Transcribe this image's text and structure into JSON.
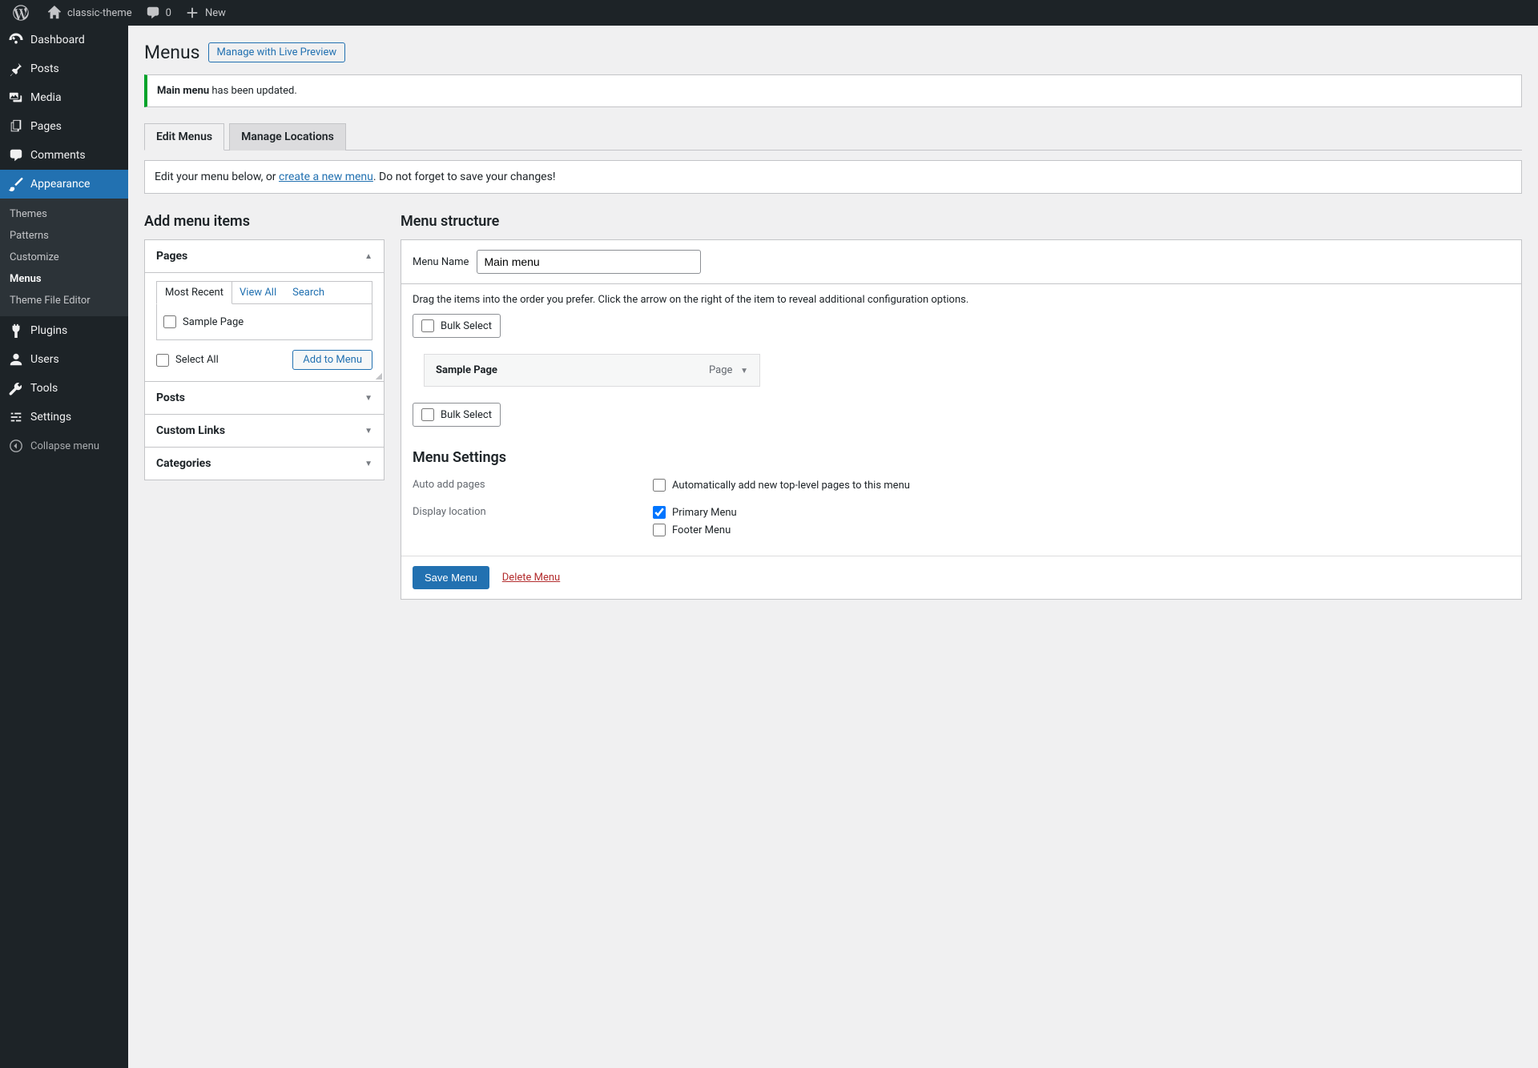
{
  "adminbar": {
    "site_name": "classic-theme",
    "comments_count": "0",
    "new_label": "New"
  },
  "sidebar": {
    "items": [
      {
        "label": "Dashboard"
      },
      {
        "label": "Posts"
      },
      {
        "label": "Media"
      },
      {
        "label": "Pages"
      },
      {
        "label": "Comments"
      },
      {
        "label": "Appearance"
      },
      {
        "label": "Plugins"
      },
      {
        "label": "Users"
      },
      {
        "label": "Tools"
      },
      {
        "label": "Settings"
      }
    ],
    "appearance_submenu": [
      {
        "label": "Themes"
      },
      {
        "label": "Patterns"
      },
      {
        "label": "Customize"
      },
      {
        "label": "Menus"
      },
      {
        "label": "Theme File Editor"
      }
    ],
    "collapse_label": "Collapse menu"
  },
  "page": {
    "title": "Menus",
    "live_preview": "Manage with Live Preview",
    "notice_strong": "Main menu",
    "notice_rest": " has been updated.",
    "tabs": {
      "edit": "Edit Menus",
      "locations": "Manage Locations"
    },
    "hint_pre": "Edit your menu below, or ",
    "hint_link": "create a new menu",
    "hint_post": ". Do not forget to save your changes!"
  },
  "add_items": {
    "heading": "Add menu items",
    "pages_label": "Pages",
    "subtabs": {
      "recent": "Most Recent",
      "viewall": "View All",
      "search": "Search"
    },
    "page_option": "Sample Page",
    "select_all": "Select All",
    "add_button": "Add to Menu",
    "posts_label": "Posts",
    "custom_links_label": "Custom Links",
    "categories_label": "Categories"
  },
  "structure": {
    "heading": "Menu structure",
    "name_label": "Menu Name",
    "name_value": "Main menu",
    "instructions": "Drag the items into the order you prefer. Click the arrow on the right of the item to reveal additional configuration options.",
    "bulk_select": "Bulk Select",
    "item_title": "Sample Page",
    "item_type": "Page",
    "settings_heading": "Menu Settings",
    "auto_add_label": "Auto add pages",
    "auto_add_option": "Automatically add new top-level pages to this menu",
    "location_label": "Display location",
    "primary_menu": "Primary Menu",
    "footer_menu": "Footer Menu",
    "save_button": "Save Menu",
    "delete_link": "Delete Menu"
  }
}
